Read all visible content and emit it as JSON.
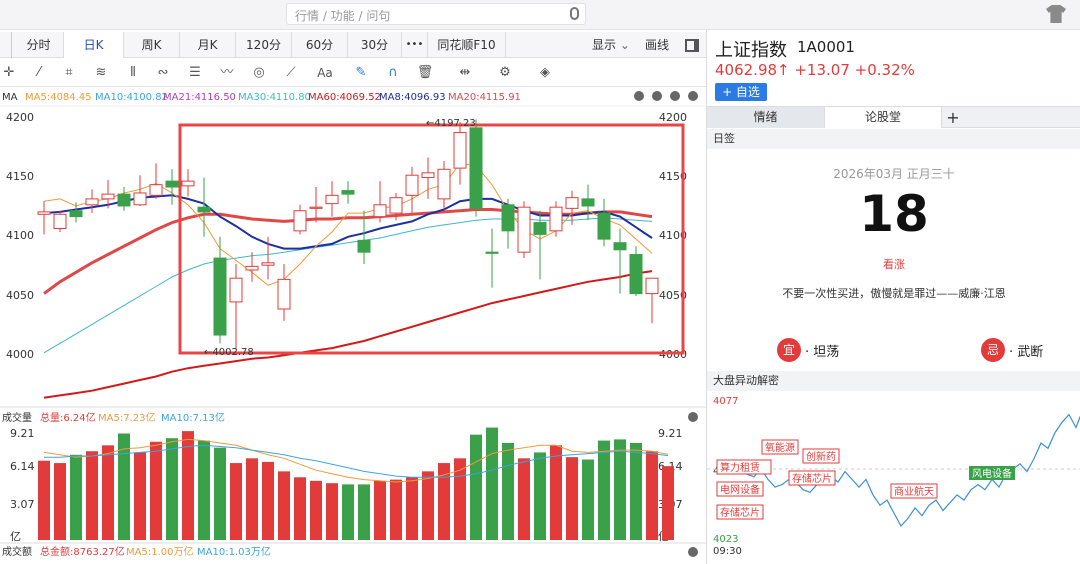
{
  "search": {
    "placeholder": "行情 / 功能 / 问句"
  },
  "tabs": [
    {
      "label": "分时"
    },
    {
      "label": "日K"
    },
    {
      "label": "周K"
    },
    {
      "label": "月K"
    },
    {
      "label": "120分"
    },
    {
      "label": "60分"
    },
    {
      "label": "30分"
    },
    {
      "label": "•••"
    },
    {
      "label": "同花顺F10"
    }
  ],
  "tab_right": {
    "display_label": "显示",
    "draw_label": "画线"
  },
  "toolbar_icons": [
    "crosshair-icon",
    "line-icon",
    "crop-icon",
    "fan-icon",
    "bars-icon",
    "link-icon",
    "list-icon",
    "wave-icon",
    "cycle-icon",
    "ruler-icon",
    "text-icon",
    "pen-icon",
    "magnet-icon",
    "trash-icon",
    "move-icon",
    "gear-icon",
    "layers-icon"
  ],
  "toolbar_text_label": "Aa",
  "ma_legend": {
    "label": "MA",
    "items": [
      {
        "text": "MA5:4084.45",
        "color": "#f29a38"
      },
      {
        "text": "MA10:4100.82",
        "color": "#3aa6e0"
      },
      {
        "text": "MA21:4116.50",
        "color": "#b03fb0"
      },
      {
        "text": "MA30:4110.80",
        "color": "#3fb7c9"
      },
      {
        "text": "MA60:4069.52",
        "color": "#d11a1a"
      },
      {
        "text": "MA8:4096.93",
        "color": "#1c2fa3"
      },
      {
        "text": "MA20:4115.91",
        "color": "#e04848"
      }
    ]
  },
  "price_axis": {
    "ticks": [
      "4200",
      "4150",
      "4100",
      "4050",
      "4000"
    ],
    "right_ticks": [
      "4200",
      "4150",
      "4100",
      "4050",
      "4000"
    ]
  },
  "annotations": {
    "high": "←4197.23",
    "low": "←4002.78"
  },
  "volume_legend": {
    "label": "成交量",
    "items": [
      {
        "text": "总量:6.24亿",
        "color": "#e23b3b"
      },
      {
        "text": "MA5:7.23亿",
        "color": "#f29a38"
      },
      {
        "text": "MA10:7.13亿",
        "color": "#3aa6e0"
      }
    ]
  },
  "volume_axis": {
    "ticks": [
      "9.21",
      "6.14",
      "3.07",
      "亿"
    ]
  },
  "amount_legend": {
    "label": "成交额",
    "items": [
      {
        "text": "总金额:8763.27亿",
        "color": "#e23b3b"
      },
      {
        "text": "MA5:1.00万亿",
        "color": "#f29a38"
      },
      {
        "text": "MA10:1.03万亿",
        "color": "#3aa6e0"
      }
    ]
  },
  "colors": {
    "up": "#e23b3b",
    "down": "#3aa04a",
    "highlight": "#e84545"
  },
  "chart_data": {
    "type": "candlestick",
    "ylim": [
      3985,
      4210
    ],
    "candles": [
      {
        "o": 4117,
        "c": 4119,
        "h": 4128,
        "l": 4100
      },
      {
        "o": 4105,
        "c": 4117,
        "h": 4120,
        "l": 4102
      },
      {
        "o": 4120,
        "c": 4115,
        "h": 4127,
        "l": 4110
      },
      {
        "o": 4125,
        "c": 4130,
        "h": 4138,
        "l": 4118
      },
      {
        "o": 4130,
        "c": 4134,
        "h": 4146,
        "l": 4122
      },
      {
        "o": 4134,
        "c": 4124,
        "h": 4140,
        "l": 4120
      },
      {
        "o": 4125,
        "c": 4135,
        "h": 4150,
        "l": 4124
      },
      {
        "o": 4133,
        "c": 4142,
        "h": 4160,
        "l": 4130
      },
      {
        "o": 4145,
        "c": 4140,
        "h": 4155,
        "l": 4125
      },
      {
        "o": 4141,
        "c": 4145,
        "h": 4155,
        "l": 4132
      },
      {
        "o": 4123,
        "c": 4119,
        "h": 4148,
        "l": 4098
      },
      {
        "o": 4080,
        "c": 4015,
        "h": 4098,
        "l": 4008
      },
      {
        "o": 4043,
        "c": 4063,
        "h": 4075,
        "l": 4003
      },
      {
        "o": 4070,
        "c": 4073,
        "h": 4085,
        "l": 4060
      },
      {
        "o": 4074,
        "c": 4076,
        "h": 4098,
        "l": 4062
      },
      {
        "o": 4037,
        "c": 4062,
        "h": 4075,
        "l": 4027
      },
      {
        "o": 4103,
        "c": 4120,
        "h": 4125,
        "l": 4100
      },
      {
        "o": 4122,
        "c": 4123,
        "h": 4140,
        "l": 4110
      },
      {
        "o": 4126,
        "c": 4133,
        "h": 4145,
        "l": 4115
      },
      {
        "o": 4137,
        "c": 4134,
        "h": 4145,
        "l": 4126
      },
      {
        "o": 4095,
        "c": 4085,
        "h": 4120,
        "l": 4075
      },
      {
        "o": 4115,
        "c": 4125,
        "h": 4145,
        "l": 4110
      },
      {
        "o": 4118,
        "c": 4131,
        "h": 4135,
        "l": 4112
      },
      {
        "o": 4133,
        "c": 4150,
        "h": 4157,
        "l": 4118
      },
      {
        "o": 4148,
        "c": 4152,
        "h": 4165,
        "l": 4130
      },
      {
        "o": 4130,
        "c": 4155,
        "h": 4162,
        "l": 4121
      },
      {
        "o": 4156,
        "c": 4186,
        "h": 4195,
        "l": 4142
      },
      {
        "o": 4190,
        "c": 4122,
        "h": 4197,
        "l": 4115
      },
      {
        "o": 4085,
        "c": 4084,
        "h": 4105,
        "l": 4055
      },
      {
        "o": 4125,
        "c": 4103,
        "h": 4130,
        "l": 4088
      },
      {
        "o": 4085,
        "c": 4123,
        "h": 4128,
        "l": 4080
      },
      {
        "o": 4110,
        "c": 4100,
        "h": 4120,
        "l": 4062
      },
      {
        "o": 4103,
        "c": 4123,
        "h": 4128,
        "l": 4098
      },
      {
        "o": 4122,
        "c": 4131,
        "h": 4137,
        "l": 4108
      },
      {
        "o": 4130,
        "c": 4124,
        "h": 4142,
        "l": 4112
      },
      {
        "o": 4118,
        "c": 4096,
        "h": 4130,
        "l": 4090
      },
      {
        "o": 4093,
        "c": 4087,
        "h": 4105,
        "l": 4050
      },
      {
        "o": 4083,
        "c": 4050,
        "h": 4090,
        "l": 4048
      },
      {
        "o": 4050,
        "c": 4063,
        "h": 4063,
        "l": 4025
      }
    ],
    "ma5": [
      4128,
      4130,
      4124,
      4128,
      4130,
      4135,
      4138,
      4143,
      4135,
      4125,
      4110,
      4088,
      4078,
      4068,
      4057,
      4062,
      4075,
      4090,
      4102,
      4118,
      4118,
      4122,
      4124,
      4130,
      4138,
      4142,
      4160,
      4158,
      4142,
      4120,
      4104,
      4096,
      4103,
      4118,
      4120,
      4113,
      4108,
      4096,
      4084
    ],
    "ma8": [
      4118,
      4119,
      4121,
      4123,
      4125,
      4128,
      4131,
      4132,
      4133,
      4130,
      4126,
      4115,
      4107,
      4098,
      4092,
      4088,
      4088,
      4090,
      4092,
      4098,
      4101,
      4105,
      4108,
      4111,
      4117,
      4121,
      4128,
      4130,
      4130,
      4125,
      4120,
      4116,
      4116,
      4116,
      4118,
      4119,
      4115,
      4106,
      4097
    ],
    "ma20": [
      4050,
      4060,
      4068,
      4076,
      4083,
      4090,
      4097,
      4104,
      4110,
      4114,
      4117,
      4117,
      4115,
      4113,
      4112,
      4111,
      4112,
      4113,
      4113,
      4114,
      4114,
      4115,
      4116,
      4117,
      4118,
      4119,
      4120,
      4121,
      4121,
      4120,
      4119,
      4118,
      4117,
      4117,
      4118,
      4119,
      4119,
      4117,
      4115
    ],
    "ma30": [
      4000,
      4008,
      4016,
      4024,
      4032,
      4040,
      4048,
      4056,
      4064,
      4070,
      4075,
      4078,
      4080,
      4082,
      4083,
      4085,
      4087,
      4089,
      4091,
      4093,
      4095,
      4097,
      4100,
      4103,
      4106,
      4108,
      4110,
      4112,
      4113,
      4113,
      4113,
      4112,
      4112,
      4112,
      4113,
      4114,
      4113,
      4112,
      4111
    ],
    "ma60": [
      3962,
      3964,
      3966,
      3968,
      3971,
      3974,
      3977,
      3980,
      3984,
      3987,
      3989,
      3991,
      3993,
      3995,
      3996,
      3998,
      4000,
      4002,
      4004,
      4007,
      4010,
      4014,
      4018,
      4022,
      4026,
      4030,
      4034,
      4038,
      4042,
      4045,
      4048,
      4051,
      4054,
      4057,
      4060,
      4062,
      4064,
      4067,
      4069
    ],
    "volume": [
      6.7,
      6.5,
      7.2,
      7.5,
      8.0,
      9.0,
      7.4,
      8.3,
      8.6,
      9.2,
      8.4,
      7.8,
      6.5,
      6.9,
      6.6,
      5.8,
      5.3,
      5.0,
      4.8,
      4.7,
      4.7,
      5.0,
      5.1,
      5.3,
      5.8,
      6.5,
      6.9,
      8.9,
      9.5,
      8.2,
      6.9,
      7.4,
      8.0,
      7.0,
      6.8,
      8.4,
      8.5,
      8.2,
      7.5,
      6.24
    ],
    "vol_ma5": [
      7.4,
      7.2,
      7.0,
      7.1,
      7.3,
      7.7,
      7.8,
      8.0,
      8.3,
      8.5,
      8.4,
      8.2,
      8.0,
      7.6,
      7.2,
      6.9,
      6.4,
      5.9,
      5.6,
      5.3,
      5.1,
      5.0,
      4.9,
      5.0,
      5.2,
      5.5,
      5.9,
      6.6,
      7.3,
      7.6,
      7.8,
      8.0,
      8.0,
      7.5,
      7.4,
      7.5,
      7.6,
      7.6,
      7.5,
      7.23
    ],
    "vol_ma10": [
      7.0,
      7.0,
      7.1,
      7.1,
      7.2,
      7.3,
      7.4,
      7.5,
      7.7,
      7.9,
      8.0,
      7.9,
      7.8,
      7.6,
      7.4,
      7.2,
      6.9,
      6.7,
      6.4,
      6.1,
      5.8,
      5.6,
      5.4,
      5.3,
      5.3,
      5.3,
      5.4,
      5.6,
      5.9,
      6.3,
      6.6,
      6.9,
      7.1,
      7.2,
      7.3,
      7.4,
      7.5,
      7.4,
      7.3,
      7.13
    ],
    "vol_ylim": [
      0,
      9.8
    ]
  },
  "right": {
    "title": "上证指数",
    "code": "1A0001",
    "price": "4062.98↑ +13.07 +0.32%",
    "add_button": "+ 自选",
    "tabs": [
      {
        "label": "情绪"
      },
      {
        "label": "论股堂"
      },
      {
        "label": "+"
      }
    ],
    "calendar_header": "日签",
    "calendar_date": "2026年03月 正月三十",
    "calendar_day": "18",
    "calendar_status": "看涨",
    "quote": "不要一次性买进，傲慢就是罪过——威廉·江恩",
    "yi_badge": "宜",
    "yi_text": "· 坦荡",
    "ji_badge": "忌",
    "ji_text": "· 武断",
    "anomaly_header": "大盘异动解密",
    "mini_axis": {
      "top": "4077",
      "mid": "4050",
      "bottom": "4023",
      "time": "09:30"
    },
    "mini_tags": [
      {
        "text": "氧能源"
      },
      {
        "text": "创新药"
      },
      {
        "text": "算力租赁"
      },
      {
        "text": "电网设备"
      },
      {
        "text": "存储芯片"
      },
      {
        "text": "存储芯片"
      },
      {
        "text": "商业航天"
      },
      {
        "text": "风电设备"
      }
    ],
    "mini_line": [
      4048,
      4047,
      4050,
      4046,
      4043,
      4044,
      4046,
      4045,
      4042,
      4041,
      4044,
      4046,
      4047,
      4045,
      4049,
      4046,
      4043,
      4046,
      4040,
      4036,
      4038,
      4033,
      4028,
      4031,
      4035,
      4032,
      4036,
      4038,
      4034,
      4037,
      4040,
      4038,
      4042,
      4044,
      4042,
      4046,
      4043,
      4048,
      4050,
      4052,
      4049,
      4054,
      4060,
      4058,
      4064,
      4068,
      4071,
      4066,
      4073
    ]
  }
}
